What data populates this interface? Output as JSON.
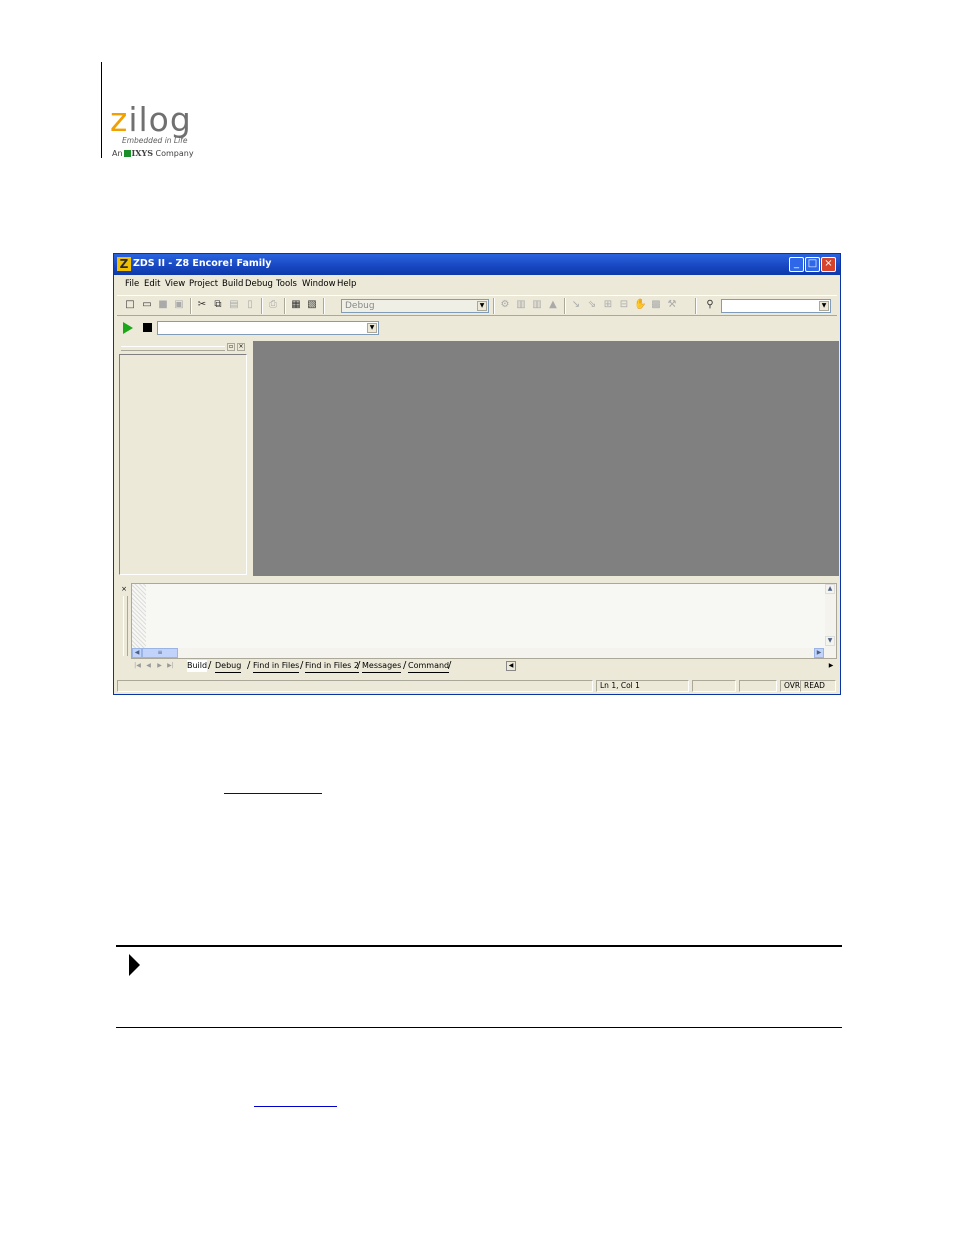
{
  "header": {
    "logo_main": "zilog",
    "logo_tagline": "Embedded in Life",
    "logo_company_prefix": "An",
    "logo_company_name": "IXYS",
    "logo_company_suffix": "Company"
  },
  "window": {
    "title": "ZDS II - Z8 Encore! Family",
    "app_icon": "Z",
    "controls": [
      "minimize",
      "maximize",
      "close"
    ]
  },
  "menu": [
    "File",
    "Edit",
    "View",
    "Project",
    "Build",
    "Debug",
    "Tools",
    "Window",
    "Help"
  ],
  "toolbar": {
    "config_value": "Debug",
    "find_value": "",
    "debug_target_value": ""
  },
  "output_tabs": [
    "Build",
    "Debug",
    "Find in Files",
    "Find in Files 2",
    "Messages",
    "Command"
  ],
  "status": {
    "position": "Ln 1, Col 1",
    "mode_ovr": "OVR",
    "mode_read": "READ"
  },
  "colors": {
    "titlebar": "#1746c0",
    "mdi_background": "#808080",
    "chrome": "#ece9d8",
    "logo_accent": "#f0a000",
    "run_green": "#1aa81a"
  }
}
